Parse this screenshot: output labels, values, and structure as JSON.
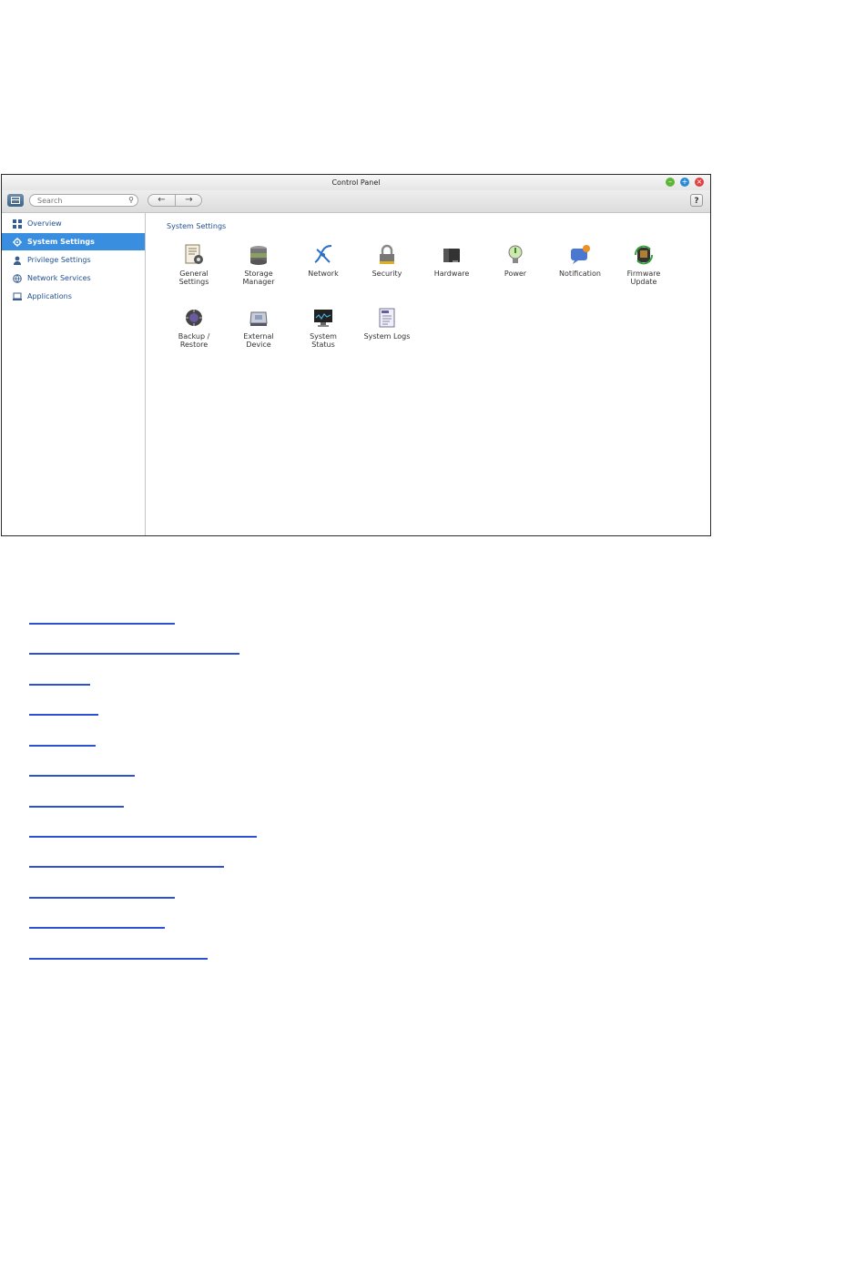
{
  "window": {
    "title": "Control Panel",
    "buttons": {
      "minimize": "–",
      "maximize": "+",
      "close": "×"
    }
  },
  "toolbar": {
    "search_placeholder": "Search",
    "back": "←",
    "forward": "→",
    "help": "?"
  },
  "sidebar": {
    "items": [
      {
        "label": "Overview",
        "icon": "overview-icon"
      },
      {
        "label": "System Settings",
        "icon": "gear-icon",
        "active": true
      },
      {
        "label": "Privilege Settings",
        "icon": "user-icon"
      },
      {
        "label": "Network Services",
        "icon": "globe-icon"
      },
      {
        "label": "Applications",
        "icon": "drive-icon"
      }
    ]
  },
  "main": {
    "section_title": "System Settings",
    "items": [
      {
        "label": "General\nSettings",
        "icon": "general-settings-icon"
      },
      {
        "label": "Storage\nManager",
        "icon": "storage-manager-icon"
      },
      {
        "label": "Network",
        "icon": "network-icon"
      },
      {
        "label": "Security",
        "icon": "lock-icon"
      },
      {
        "label": "Hardware",
        "icon": "hardware-icon"
      },
      {
        "label": "Power",
        "icon": "power-icon"
      },
      {
        "label": "Notification",
        "icon": "notification-icon"
      },
      {
        "label": "Firmware\nUpdate",
        "icon": "firmware-update-icon"
      },
      {
        "label": "Backup /\nRestore",
        "icon": "backup-restore-icon"
      },
      {
        "label": "External\nDevice",
        "icon": "external-device-icon"
      },
      {
        "label": "System\nStatus",
        "icon": "system-status-icon"
      },
      {
        "label": "System Logs",
        "icon": "system-logs-icon"
      }
    ]
  },
  "links_count": 12,
  "colors": {
    "accent": "#3a8ee0",
    "link": "#2c4fd6"
  }
}
